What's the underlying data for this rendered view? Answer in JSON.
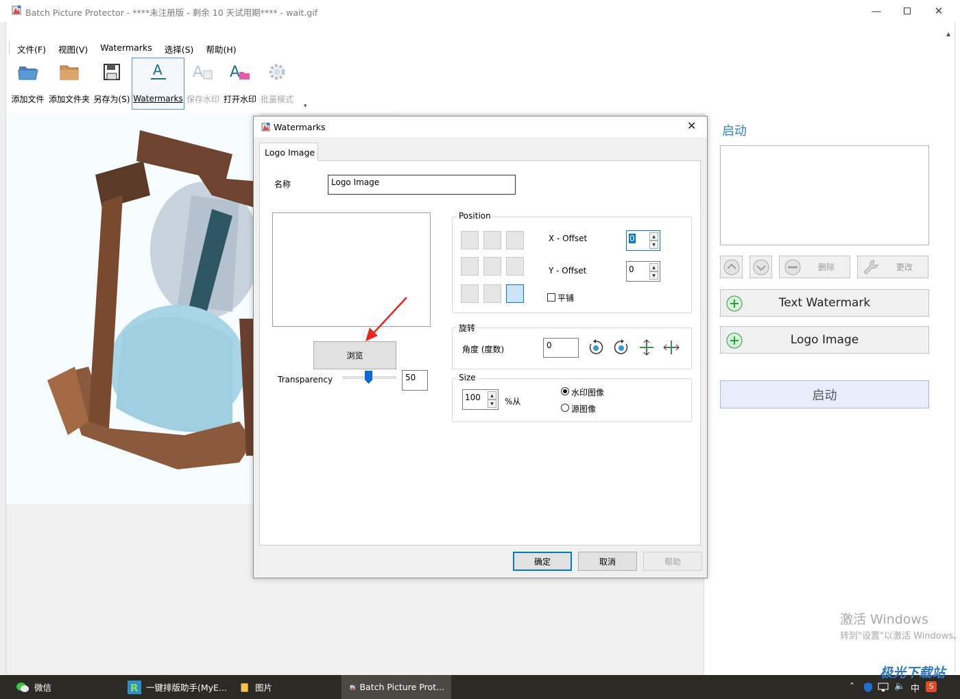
{
  "window": {
    "title": "Batch Picture Protector - ****未注册版 - 剩余 10 天试用期**** - wait.gif"
  },
  "menu": [
    "文件(F)",
    "视图(V)",
    "Watermarks",
    "选择(S)",
    "帮助(H)"
  ],
  "toolbar": [
    {
      "label": "添加文件",
      "icon": "folder-open-icon",
      "enabled": true
    },
    {
      "label": "添加文件夹",
      "icon": "folder-icon",
      "enabled": true
    },
    {
      "label": "另存为(S)",
      "icon": "save-icon",
      "enabled": true
    },
    {
      "label": "Watermarks",
      "icon": "text-watermark-icon",
      "enabled": true,
      "active": true
    },
    {
      "label": "保存水印",
      "icon": "save-watermark-icon",
      "enabled": false
    },
    {
      "label": "打开水印",
      "icon": "open-watermark-icon",
      "enabled": true
    },
    {
      "label": "批量模式",
      "icon": "gear-icon",
      "enabled": false
    }
  ],
  "dialog": {
    "title": "Watermarks",
    "tab": "Logo Image",
    "name_label": "名称",
    "name_value": "Logo Image",
    "browse_label": "浏览",
    "transparency_label": "Transparency",
    "transparency_value": "50",
    "transparency_fraction": 0.5,
    "position": {
      "title": "Position",
      "selected_cell": 8,
      "x_offset_label": "X - Offset",
      "x_offset_value": "0",
      "y_offset_label": "Y - Offset",
      "y_offset_value": "0",
      "tile_label": "平铺",
      "tile_checked": false
    },
    "rotation": {
      "title": "旋转",
      "angle_label": "角度 (度数)",
      "angle_value": "0"
    },
    "size": {
      "title": "Size",
      "value": "100",
      "percent_label": "%从",
      "options": [
        "水印图像",
        "源图像"
      ],
      "selected": 0
    },
    "buttons": {
      "ok": "确定",
      "cancel": "取消",
      "help": "帮助"
    }
  },
  "right_panel": {
    "title": "启动",
    "delete_label": "删除",
    "edit_label": "更改",
    "text_watermark_label": "Text Watermark",
    "logo_image_label": "Logo Image",
    "start_label": "启动"
  },
  "activation": {
    "line1": "激活 Windows",
    "line2": "转到\"设置\"以激活 Windows。"
  },
  "taskbar": {
    "items": [
      "微信",
      "一键排版助手(MyE...",
      "图片",
      "Batch Picture Prot..."
    ],
    "ime": "中"
  },
  "site_watermark": "极光下载站",
  "colors": {
    "accent": "#0078d7",
    "title_blue": "#2f84d0",
    "start_bg": "#e6eefb",
    "taskbar": "#2c2a25"
  }
}
